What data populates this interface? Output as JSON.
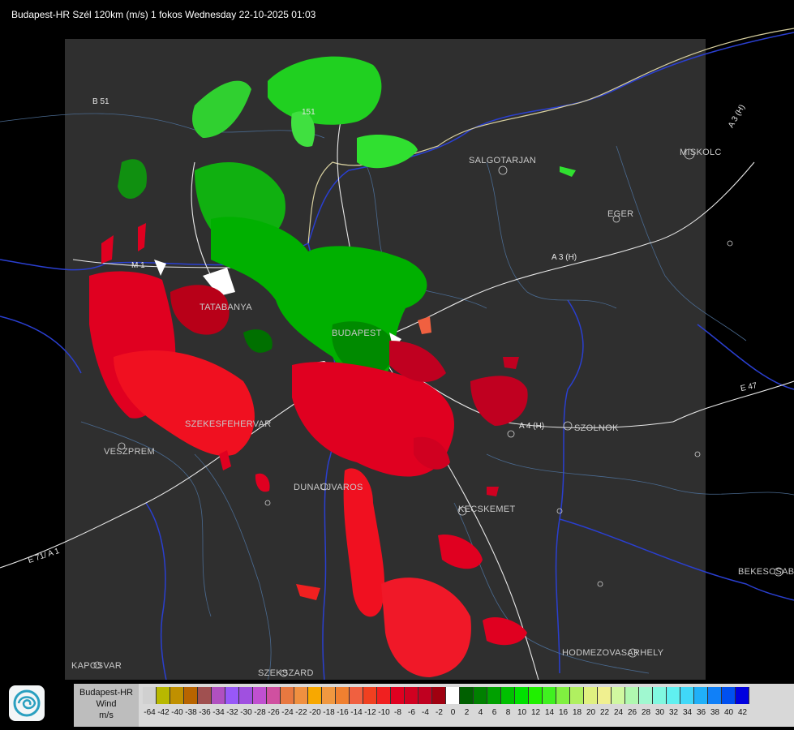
{
  "header": {
    "title": "Budapest-HR Szél 120km (m/s) 1 fokos Wednesday 22-10-2025 01:03"
  },
  "cities": [
    {
      "name": "SALGOTARJAN",
      "id": "city-salgotarjan"
    },
    {
      "name": "MISKOLC",
      "id": "city-miskolc"
    },
    {
      "name": "EGER",
      "id": "city-eger"
    },
    {
      "name": "TATABANYA",
      "id": "city-tatabanya"
    },
    {
      "name": "BUDAPEST",
      "id": "city-budapest"
    },
    {
      "name": "SZEKESFEHERVAR",
      "id": "city-szekesfehervar"
    },
    {
      "name": "VESZPREM",
      "id": "city-veszprem"
    },
    {
      "name": "SZOLNOK",
      "id": "city-szolnok"
    },
    {
      "name": "DUNAUJVAROS",
      "id": "city-dunaujvaros"
    },
    {
      "name": "KECSKEMET",
      "id": "city-kecskemet"
    },
    {
      "name": "BEKESCSABA",
      "id": "city-bekescsaba"
    },
    {
      "name": "HODMEZOVASARHELY",
      "id": "city-hodmezovasarhely"
    },
    {
      "name": "KAPOSVAR",
      "id": "city-kaposvar"
    },
    {
      "name": "SZEKSZARD",
      "id": "city-szekszard"
    }
  ],
  "roads": [
    {
      "name": "B 51",
      "id": "road-b51"
    },
    {
      "name": "E 71/ A 1",
      "id": "road-e71"
    },
    {
      "name": "A 3 (H)",
      "id": "road-a3-north"
    },
    {
      "name": "A 3 (H)",
      "id": "road-a3"
    },
    {
      "name": "E 47",
      "id": "road-e47"
    },
    {
      "name": "A 4 (H)",
      "id": "road-a4"
    },
    {
      "name": "M 1",
      "id": "road-m1"
    },
    {
      "name": "151",
      "id": "road-151"
    }
  ],
  "legend": {
    "title": "Budapest-HR",
    "quantity": "Wind",
    "unit": "m/s",
    "colors": [
      "#d0d0d0",
      "#b8b800",
      "#c09000",
      "#b86400",
      "#a05050",
      "#b050c0",
      "#9858f8",
      "#a050e0",
      "#c050d0",
      "#d050a0",
      "#e87840",
      "#f09040",
      "#f8a800",
      "#f09840",
      "#f08030",
      "#f06040",
      "#f04020",
      "#f02020",
      "#e00020",
      "#d00020",
      "#c00020",
      "#a00010",
      "#ffffff",
      "#006000",
      "#008000",
      "#00a000",
      "#00c000",
      "#00e000",
      "#20f000",
      "#40f020",
      "#80f040",
      "#b0f060",
      "#e0f080",
      "#f0f090",
      "#d0f8a0",
      "#b0f8b0",
      "#a0f8d0",
      "#80f8e0",
      "#60f0f0",
      "#40d8f8",
      "#20b0f8",
      "#1080f8",
      "#0050f0",
      "#0000e0"
    ],
    "ticks": [
      "-64",
      "-42",
      "-40",
      "-38",
      "-36",
      "-34",
      "-32",
      "-30",
      "-28",
      "-26",
      "-24",
      "-22",
      "-20",
      "-18",
      "-16",
      "-14",
      "-12",
      "-10",
      "-8",
      "-6",
      "-4",
      "-2",
      "0",
      "2",
      "4",
      "6",
      "8",
      "10",
      "12",
      "14",
      "16",
      "18",
      "20",
      "22",
      "24",
      "26",
      "28",
      "30",
      "32",
      "34",
      "36",
      "38",
      "40",
      "42"
    ]
  }
}
